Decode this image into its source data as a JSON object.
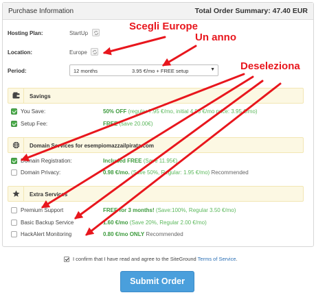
{
  "header": {
    "title": "Purchase Information",
    "summary": "Total Order Summary: 47.40 EUR"
  },
  "hosting": {
    "label": "Hosting Plan:",
    "value": "StartUp"
  },
  "location": {
    "label": "Location:",
    "value": "Europe"
  },
  "period": {
    "label": "Period:",
    "selected": "12 months                        3.95 €/mo + FREE setup"
  },
  "savings": {
    "title": "Savings",
    "items": [
      {
        "label": "You Save:",
        "price": "50% OFF",
        "detail": "(regular 7.95 €/mo, initial 4.95 €/mo price: 3.95 €/mo)",
        "checked": true
      },
      {
        "label": "Setup Fee:",
        "price": "FREE",
        "detail": "(save 20.00€)",
        "checked": true
      }
    ]
  },
  "domain": {
    "title": "Domain Services for esempiomazzailpirata.com",
    "items": [
      {
        "label": "Domain Registration:",
        "price": "Included FREE",
        "detail": "(Save 11.95€)",
        "suffix": "",
        "checked": true
      },
      {
        "label": "Domain Privacy:",
        "price": "0.98 €/mo.",
        "detail": "(Save 50%, Regular: 1.95 €/mo)",
        "suffix": "Recommended",
        "checked": false
      }
    ]
  },
  "extra": {
    "title": "Extra Services",
    "items": [
      {
        "label": "Premium Support",
        "price": "FREE for 3 months!",
        "detail": "(Save:100%, Regular 3.50 €/mo)",
        "suffix": "",
        "checked": false
      },
      {
        "label": "Basic Backup Service",
        "price": "1.60 €/mo",
        "detail": "(Save 20%, Regular 2.00 €/mo)",
        "suffix": "",
        "checked": false
      },
      {
        "label": "HackAlert Monitoring",
        "price": "0.80 €/mo ONLY",
        "detail": "",
        "suffix": "Recommended",
        "checked": false
      }
    ]
  },
  "confirm": {
    "text": "I confirm that I have read and agree to the SiteGround",
    "link": "Terms of Service",
    "end": "."
  },
  "submit_label": "Submit Order",
  "annotations": {
    "europe": "Scegli Europe",
    "year": "Un anno",
    "deselect": "Deseleziona",
    "color": "#e8161d"
  }
}
